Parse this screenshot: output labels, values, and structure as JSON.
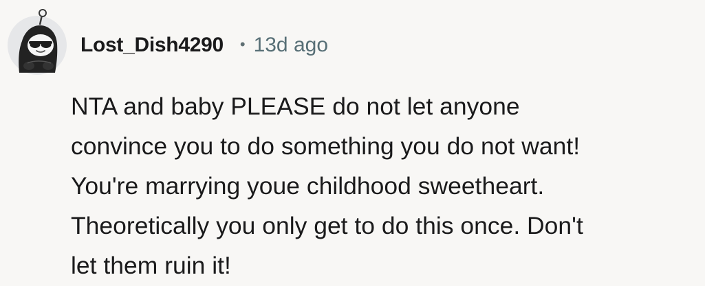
{
  "comment": {
    "author": "Lost_Dish4290",
    "separator": "•",
    "timestamp": "13d ago",
    "body_lines": [
      "NTA and baby PLEASE do not let anyone",
      "convince you to do something you do not want!",
      "You're marrying youe childhood sweetheart.",
      "Theoretically you only get to do this once. Don't",
      "let them ruin it!"
    ]
  },
  "avatar_icon": "snoo-avatar-with-sunglasses-icon",
  "colors": {
    "background": "#f8f7f5",
    "text": "#1a1a1b",
    "meta": "#576f76"
  }
}
